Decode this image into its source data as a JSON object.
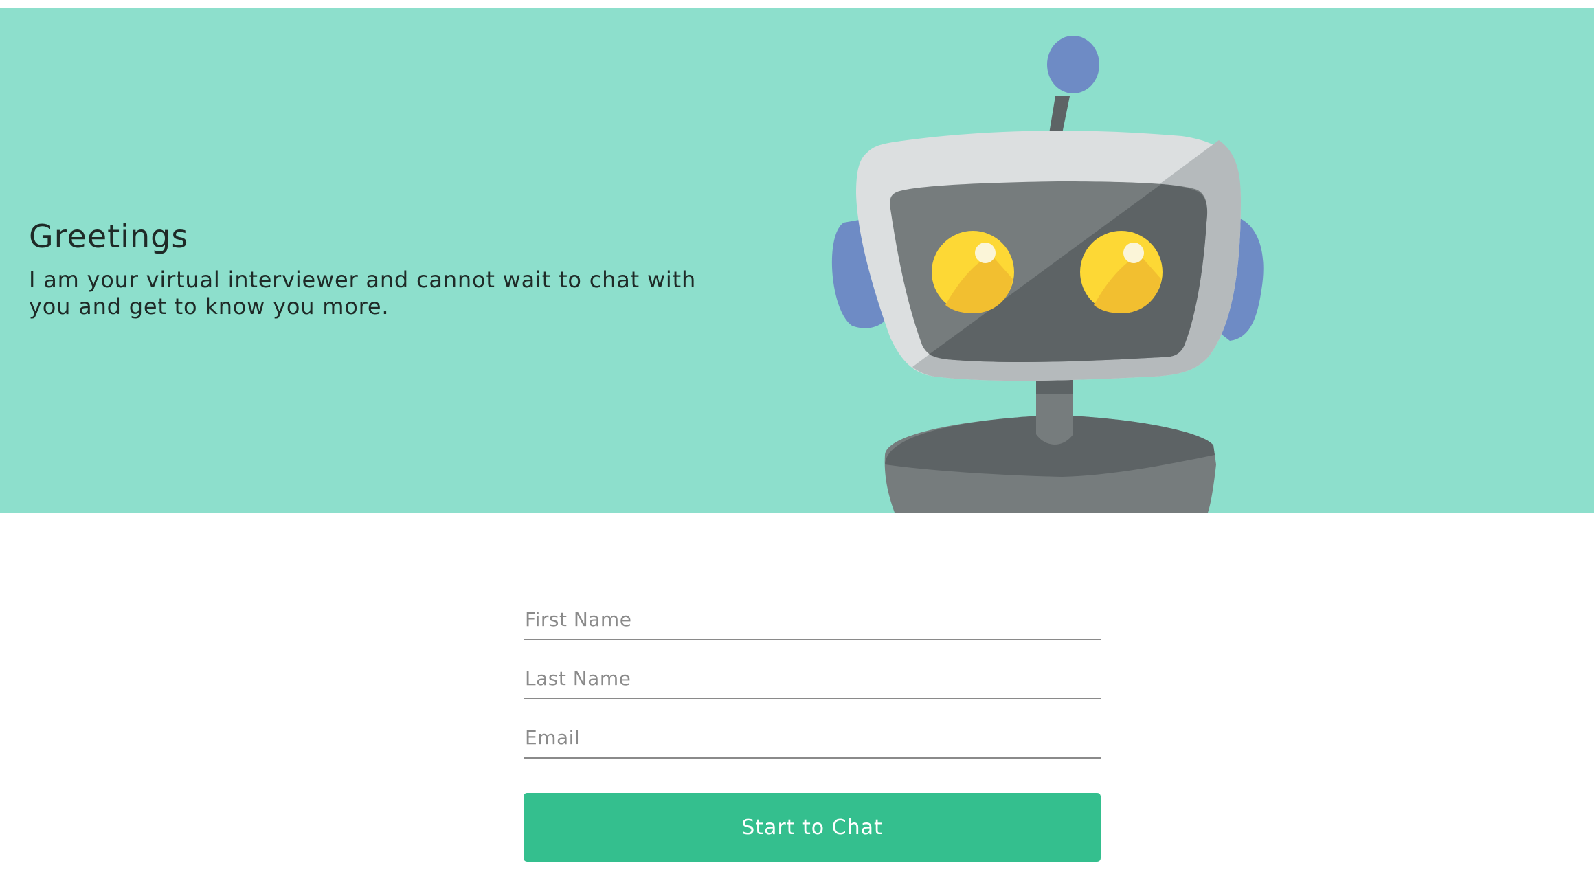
{
  "hero": {
    "title": "Greetings",
    "subtitle": "I am your virtual interviewer and cannot wait to chat with you and get to know you more.",
    "background_color": "#8ddfcc",
    "illustration": "robot-illustration"
  },
  "form": {
    "first_name": {
      "placeholder": "First Name",
      "value": ""
    },
    "last_name": {
      "placeholder": "Last Name",
      "value": ""
    },
    "email": {
      "placeholder": "Email",
      "value": ""
    },
    "submit_label": "Start to Chat",
    "button_color": "#34bf8e"
  }
}
